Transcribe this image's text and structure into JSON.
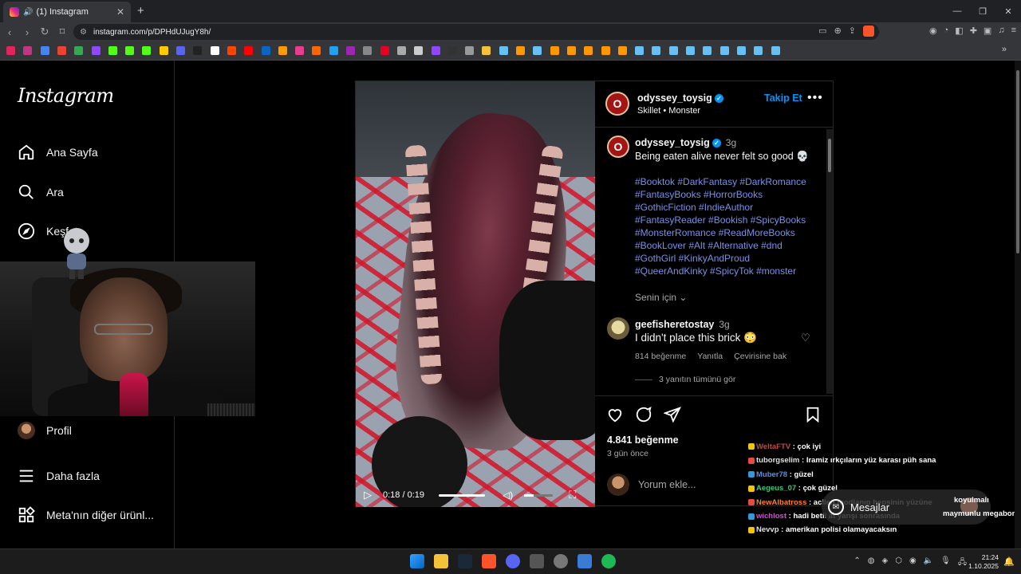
{
  "browser": {
    "tab_title": "(1) Instagram",
    "url": "instagram.com/p/DPHdUJugY8h/"
  },
  "sidebar": {
    "logo": "Instagram",
    "items": [
      {
        "label": "Ana Sayfa",
        "icon": "home-icon"
      },
      {
        "label": "Ara",
        "icon": "search-icon"
      },
      {
        "label": "Keşfet",
        "icon": "compass-icon"
      },
      {
        "label": "Profil",
        "icon": "avatar"
      },
      {
        "label": "Daha fazla",
        "icon": "menu-icon"
      },
      {
        "label": "Meta'nın diğer ürünl...",
        "icon": "grid-icon"
      }
    ]
  },
  "post": {
    "username": "odyssey_toysig",
    "audio": "Skillet • Monster",
    "follow_label": "Takip Et",
    "caption_time": "3g",
    "caption": "Being eaten alive never felt so good 💀",
    "hashtags": "#Booktok #DarkFantasy #DarkRomance #FantasyBooks #HorrorBooks #GothicFiction #IndieAuthor #FantasyReader #Bookish #SpicyBooks #MonsterRomance #ReadMoreBooks #BookLover #Alt #Alternative #dnd #GothGirl #KinkyAndProud #QueerAndKinky #SpicyTok #monster",
    "for_you": "Senin için ⌄",
    "comment": {
      "username": "geefisheretostay",
      "time": "3g",
      "text": "I didn't place this brick 😳",
      "likes": "814 beğenme",
      "reply": "Yanıtla",
      "translate": "Çevirisine bak",
      "view_replies": "3 yanıtın tümünü gör"
    },
    "likes": "4.841 beğenme",
    "posted": "3 gün önce",
    "add_comment_placeholder": "Yorum ekle...",
    "video_time": "0:18 / 0:19"
  },
  "chat": [
    {
      "user": "WeltaFTV",
      "msg": " : çok iyi",
      "color": "#c04848"
    },
    {
      "user": "tuborgselim",
      "msg": " : Iramiz ırkçıların yüz karası püh sana",
      "color": "#e0e0e0"
    },
    {
      "user": "Muber78",
      "msg": " : güzel",
      "color": "#5a8fe0"
    },
    {
      "user": "Aegeus_07",
      "msg": " : çok güzel",
      "color": "#3cc47c"
    },
    {
      "user": "NewAlbatross",
      "msg": " : acilen modlanıp hepsinin yüzüne",
      "color": "#ff7f27"
    },
    {
      "user": "wichlost",
      "msg": " : hadi betli at yarışı sonrasında",
      "color": "#d050d0"
    },
    {
      "user": "Nevvp",
      "msg": " : amerikan polisi olamayacaksın",
      "color": "#e0e0e0"
    }
  ],
  "chat_extra": {
    "koyulmali": "koyulmalı",
    "megabonk": "maymunlu megabonk"
  },
  "messages_label": "Mesajlar",
  "clock": {
    "time": "21:24",
    "date": "1.10.2025"
  },
  "colors": {
    "accent": "#0095f6",
    "hashtag": "#7b8fe8",
    "bg": "#000000"
  }
}
